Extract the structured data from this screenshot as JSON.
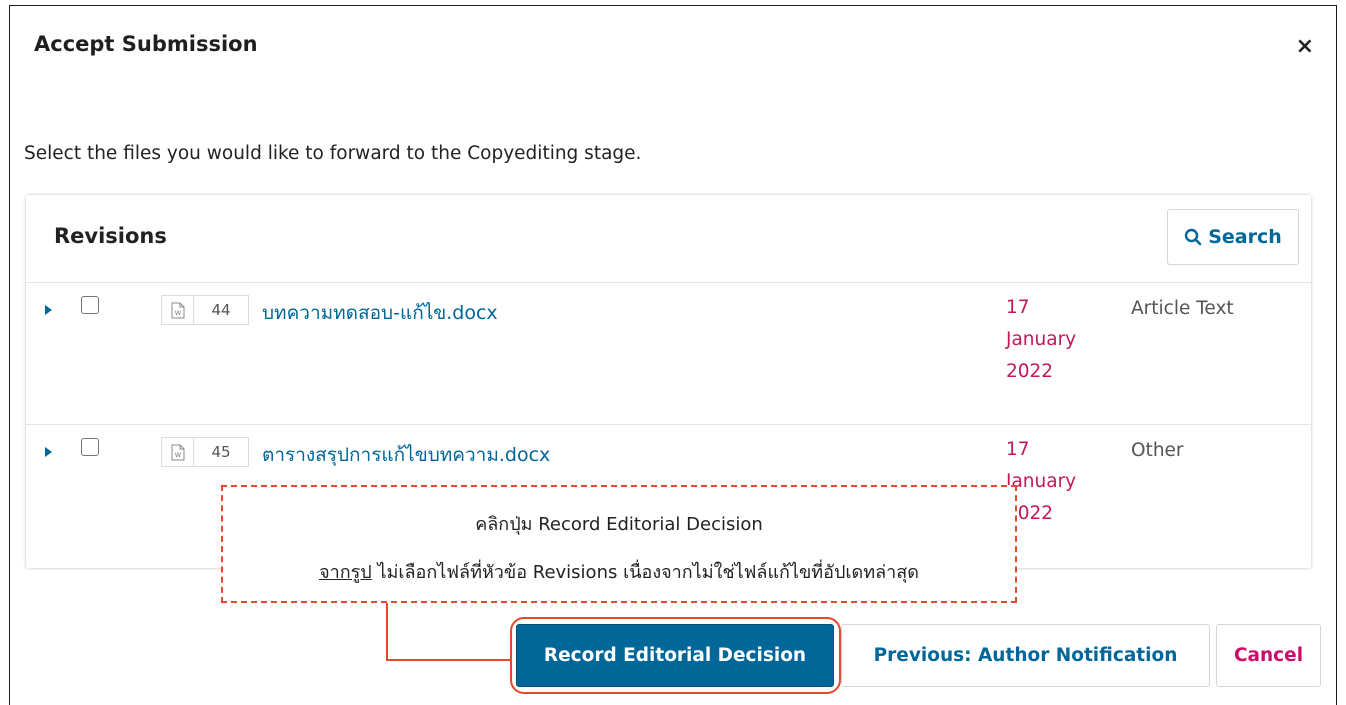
{
  "modal": {
    "title": "Accept Submission",
    "close_symbol": "×"
  },
  "instruction": "Select the files you would like to forward to the Copyediting stage.",
  "panel": {
    "title": "Revisions",
    "search_label": "Search"
  },
  "files": [
    {
      "id": "44",
      "name": "บทความทดสอบ-แก้ไข.docx",
      "date_day": "17",
      "date_month": "January",
      "date_year": "2022",
      "type": "Article Text",
      "icon": "word-document-icon"
    },
    {
      "id": "45",
      "name": "ตารางสรุปการแก้ไขบทความ.docx",
      "date_day": "17",
      "date_month": "January",
      "date_year": "2022",
      "type": "Other",
      "icon": "word-document-icon"
    }
  ],
  "actions": {
    "record": "Record Editorial Decision",
    "previous": "Previous: Author Notification",
    "cancel": "Cancel"
  },
  "callout": {
    "line1": "คลิกปุ่ม Record Editorial Decision",
    "line2_underlined": "จากรูป",
    "line2_rest": " ไม่เลือกไฟล์ที่หัวข้อ Revisions เนื่องจากไม่ใช่ไฟล์แก้ไขที่อัปเดทล่าสุด"
  },
  "colors": {
    "link": "#006798",
    "date": "#c2185b",
    "cancel": "#d00a6c",
    "annotation": "#e3492d"
  }
}
